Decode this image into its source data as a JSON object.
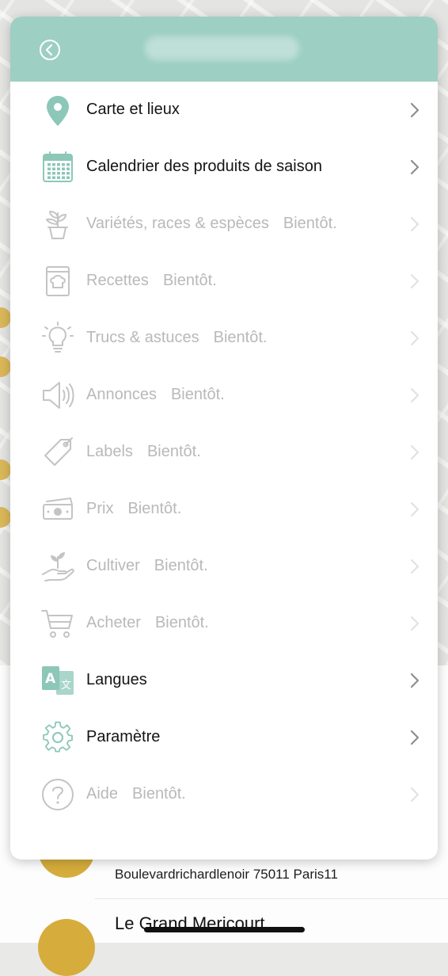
{
  "menu": {
    "items": [
      {
        "label": "Carte et lieux",
        "icon": "map-pin-icon",
        "enabled": true
      },
      {
        "label": "Calendrier des produits de saison",
        "icon": "calendar-icon",
        "enabled": true
      },
      {
        "label": "Variétés, races & espèces",
        "soon": "Bientôt.",
        "icon": "potted-plant-icon",
        "enabled": false
      },
      {
        "label": "Recettes",
        "soon": "Bientôt.",
        "icon": "recipe-book-icon",
        "enabled": false
      },
      {
        "label": "Trucs & astuces",
        "soon": "Bientôt.",
        "icon": "lightbulb-icon",
        "enabled": false
      },
      {
        "label": "Annonces",
        "soon": "Bientôt.",
        "icon": "speaker-icon",
        "enabled": false
      },
      {
        "label": "Labels",
        "soon": "Bientôt.",
        "icon": "tag-icon",
        "enabled": false
      },
      {
        "label": "Prix",
        "soon": "Bientôt.",
        "icon": "banknote-icon",
        "enabled": false
      },
      {
        "label": "Cultiver",
        "soon": "Bientôt.",
        "icon": "hand-sprout-icon",
        "enabled": false
      },
      {
        "label": "Acheter",
        "soon": "Bientôt.",
        "icon": "shopping-cart-icon",
        "enabled": false
      },
      {
        "label": "Langues",
        "icon": "translate-icon",
        "enabled": true
      },
      {
        "label": "Paramètre",
        "icon": "gear-icon",
        "enabled": true
      },
      {
        "label": "Aide",
        "soon": "Bientôt.",
        "icon": "help-icon",
        "enabled": false
      }
    ]
  },
  "background_list": {
    "address": "Boulevardrichardlenoir 75011 Paris11",
    "next_place_name": "Le Grand Mericourt"
  },
  "colors": {
    "accent": "#9dcfc3",
    "icon_teal": "#8cc7b8",
    "disabled_gray": "#b9b9b9",
    "place_gold": "#d6ad3c"
  }
}
